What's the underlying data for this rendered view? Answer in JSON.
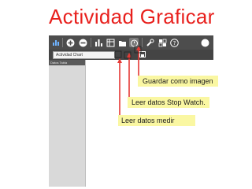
{
  "slide": {
    "title": "Actividad Graficar"
  },
  "app": {
    "toolbar_icons": [
      "chart-icon",
      "add-icon",
      "remove-icon",
      "bar-chart-icon",
      "table-icon",
      "folder-icon",
      "timer-icon",
      "wrench-icon",
      "grid-icon",
      "help-icon",
      "record-icon"
    ],
    "chart_name": "Actividad Chart",
    "panel_header": "Datos  Tabla"
  },
  "callouts": [
    {
      "text": "Guardar como imagen"
    },
    {
      "text": "Leer datos Stop Watch."
    },
    {
      "text": "Leer datos medir"
    }
  ],
  "colors": {
    "title": "#e8201d",
    "arrows": "#e53935",
    "callout_bg": "#faf7a2",
    "toolbar": "#4d4d4d"
  }
}
